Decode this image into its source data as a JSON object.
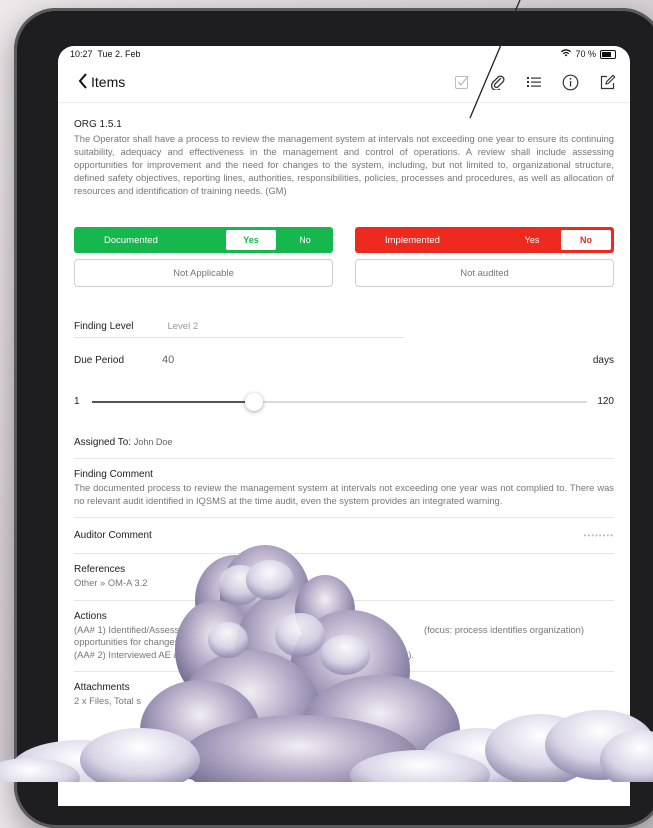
{
  "status_bar": {
    "time": "10:27",
    "date": "Tue 2. Feb",
    "battery": "70 %"
  },
  "nav": {
    "back_label": "Items",
    "icons": [
      "checkbox-icon",
      "paperclip-icon",
      "list-icon",
      "info-icon",
      "compose-icon"
    ]
  },
  "item": {
    "code": "ORG 1.5.1",
    "description": "The Operator shall have a process to review the management system at intervals not exceeding one year to ensure its continuing suitability, adequacy and effectiveness in the management and control of operations. A review shall include assessing opportunities for improvement and the need for changes to the system, including, but not limited to, organizational structure, defined safety objectives, reporting lines, authorities, responsibilities, policies, processes and procedures, as well as allocation of resources and identification of training needs. (GM)"
  },
  "documented": {
    "label": "Documented",
    "yes": "Yes",
    "no": "No",
    "selected": "Yes"
  },
  "implemented": {
    "label": "Implemented",
    "yes": "Yes",
    "no": "No",
    "selected": "No"
  },
  "not_applicable_label": "Not Applicable",
  "not_audited_label": "Not audited",
  "finding_level": {
    "label": "Finding Level",
    "value": "Level 2"
  },
  "due_period": {
    "label": "Due Period",
    "value": "40",
    "unit": "days"
  },
  "slider": {
    "min": "1",
    "max": "120",
    "value": 40
  },
  "assigned": {
    "label": "Assigned To:",
    "value": "John Doe"
  },
  "finding_comment": {
    "title": "Finding Comment",
    "body": "The documented process to review the management system at intervals not exceeding one year was not complied to. There was no relevant audit identified in IQSMS at the time audit, even the system provides an integrated warning."
  },
  "auditor_comment": {
    "title": "Auditor Comment",
    "placeholder": "••••••••"
  },
  "references": {
    "title": "References",
    "body": "Other » OM-A 3.2"
  },
  "actions": {
    "title": "Actions",
    "line1a": "(AA# 1) Identified/Assessed",
    "line1b": "(focus: process identifies organization)",
    "line2": "opportunities for changes/",
    "line3a": "(AA# 2) Interviewed AE and",
    "line3b": "(s)."
  },
  "attachments": {
    "title": "Attachments",
    "body": "2 x Files, Total s"
  },
  "colors": {
    "documented": "#16b84e",
    "implemented": "#ee2a1f"
  }
}
